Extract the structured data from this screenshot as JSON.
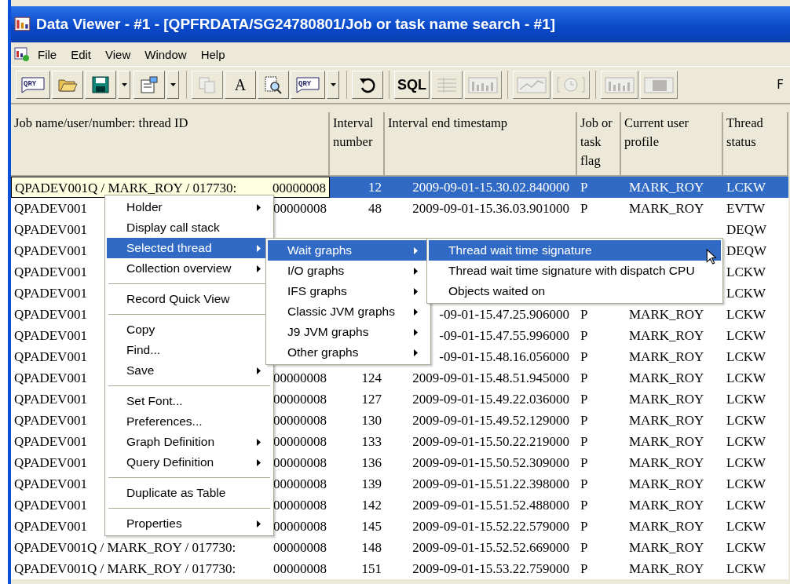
{
  "window": {
    "title": "Data Viewer - #1 - [QPFRDATA/SG24780801/Job or task name search - #1]"
  },
  "menubar": [
    "File",
    "Edit",
    "View",
    "Window",
    "Help"
  ],
  "toolbar": [
    {
      "kind": "qry",
      "label": "QRY",
      "disabled": false,
      "dropdown": false,
      "group_start": false
    },
    {
      "kind": "folder",
      "disabled": false,
      "dropdown": false,
      "group_start": false
    },
    {
      "kind": "save",
      "disabled": false,
      "dropdown": true,
      "group_start": false
    },
    {
      "kind": "properties",
      "disabled": false,
      "dropdown": true,
      "group_start": false
    },
    {
      "kind": "copy",
      "disabled": true,
      "dropdown": false,
      "group_start": true
    },
    {
      "kind": "letter",
      "label": "A",
      "disabled": false,
      "dropdown": false,
      "group_start": false
    },
    {
      "kind": "find",
      "disabled": false,
      "dropdown": false,
      "group_start": false
    },
    {
      "kind": "qry",
      "label": "QRY",
      "disabled": false,
      "dropdown": true,
      "group_start": false
    },
    {
      "kind": "refresh",
      "disabled": false,
      "dropdown": false,
      "group_start": true
    },
    {
      "kind": "letter",
      "label": "SQL",
      "disabled": false,
      "dropdown": false,
      "group_start": true
    },
    {
      "kind": "table",
      "disabled": true,
      "dropdown": false,
      "group_start": false
    },
    {
      "kind": "bars",
      "disabled": true,
      "dropdown": false,
      "group_start": false
    },
    {
      "kind": "line",
      "disabled": true,
      "dropdown": false,
      "group_start": true
    },
    {
      "kind": "clock",
      "disabled": true,
      "dropdown": false,
      "group_start": false
    },
    {
      "kind": "bars",
      "disabled": true,
      "dropdown": false,
      "group_start": true
    },
    {
      "kind": "block",
      "disabled": true,
      "dropdown": false,
      "group_start": false
    }
  ],
  "toolbar_edge_text": "F",
  "table": {
    "columns": [
      "Job name/user/number: thread ID",
      "Interval number",
      "Interval end timestamp",
      "Job or task flag",
      "Current user profile",
      "Thread status"
    ],
    "rows": [
      {
        "job": "QPADEV001Q / MARK_ROY / 017730:",
        "thread": "00000008",
        "interval": "12",
        "timestamp": "2009-09-01-15.30.02.840000",
        "flag": "P",
        "user": "MARK_ROY",
        "status": "LCKW",
        "selected": true
      },
      {
        "job": "QPADEV001",
        "thread": "00000008",
        "interval": "48",
        "timestamp": "2009-09-01-15.36.03.901000",
        "flag": "P",
        "user": "MARK_ROY",
        "status": "EVTW",
        "selected": false
      },
      {
        "job": "QPADEV001",
        "status": "DEQW",
        "selected": false
      },
      {
        "job": "QPADEV001",
        "status": "DEQW",
        "selected": false
      },
      {
        "job": "QPADEV001",
        "status": "LCKW",
        "selected": false
      },
      {
        "job": "QPADEV001",
        "status": "LCKW",
        "selected": false
      },
      {
        "job": "QPADEV001",
        "timestamp": "-09-01-15.47.25.906000",
        "flag": "P",
        "user": "MARK_ROY",
        "status": "LCKW",
        "selected": false
      },
      {
        "job": "QPADEV001",
        "timestamp": "-09-01-15.47.55.996000",
        "flag": "P",
        "user": "MARK_ROY",
        "status": "LCKW",
        "selected": false
      },
      {
        "job": "QPADEV001",
        "timestamp": "-09-01-15.48.16.056000",
        "flag": "P",
        "user": "MARK_ROY",
        "status": "LCKW",
        "selected": false
      },
      {
        "job": "QPADEV001",
        "thread": "00000008",
        "interval": "124",
        "timestamp": "2009-09-01-15.48.51.945000",
        "flag": "P",
        "user": "MARK_ROY",
        "status": "LCKW",
        "selected": false
      },
      {
        "job": "QPADEV001",
        "thread": "00000008",
        "interval": "127",
        "timestamp": "2009-09-01-15.49.22.036000",
        "flag": "P",
        "user": "MARK_ROY",
        "status": "LCKW",
        "selected": false
      },
      {
        "job": "QPADEV001",
        "thread": "00000008",
        "interval": "130",
        "timestamp": "2009-09-01-15.49.52.129000",
        "flag": "P",
        "user": "MARK_ROY",
        "status": "LCKW",
        "selected": false
      },
      {
        "job": "QPADEV001",
        "thread": "00000008",
        "interval": "133",
        "timestamp": "2009-09-01-15.50.22.219000",
        "flag": "P",
        "user": "MARK_ROY",
        "status": "LCKW",
        "selected": false
      },
      {
        "job": "QPADEV001",
        "thread": "00000008",
        "interval": "136",
        "timestamp": "2009-09-01-15.50.52.309000",
        "flag": "P",
        "user": "MARK_ROY",
        "status": "LCKW",
        "selected": false
      },
      {
        "job": "QPADEV001",
        "thread": "00000008",
        "interval": "139",
        "timestamp": "2009-09-01-15.51.22.398000",
        "flag": "P",
        "user": "MARK_ROY",
        "status": "LCKW",
        "selected": false
      },
      {
        "job": "QPADEV001",
        "thread": "00000008",
        "interval": "142",
        "timestamp": "2009-09-01-15.51.52.488000",
        "flag": "P",
        "user": "MARK_ROY",
        "status": "LCKW",
        "selected": false
      },
      {
        "job": "QPADEV001",
        "thread": "00000008",
        "interval": "145",
        "timestamp": "2009-09-01-15.52.22.579000",
        "flag": "P",
        "user": "MARK_ROY",
        "status": "LCKW",
        "selected": false
      },
      {
        "job": "QPADEV001Q / MARK_ROY / 017730:",
        "thread": "00000008",
        "interval": "148",
        "timestamp": "2009-09-01-15.52.52.669000",
        "flag": "P",
        "user": "MARK_ROY",
        "status": "LCKW",
        "selected": false
      },
      {
        "job": "QPADEV001Q / MARK_ROY / 017730:",
        "thread": "00000008",
        "interval": "151",
        "timestamp": "2009-09-01-15.53.22.759000",
        "flag": "P",
        "user": "MARK_ROY",
        "status": "LCKW",
        "selected": false
      }
    ]
  },
  "context_menu": [
    {
      "kind": "item",
      "label": "Holder",
      "submenu": true,
      "selected": false
    },
    {
      "kind": "item",
      "label": "Display call stack",
      "submenu": false,
      "selected": false
    },
    {
      "kind": "item",
      "label": "Selected thread",
      "submenu": true,
      "selected": true
    },
    {
      "kind": "item",
      "label": "Collection overview",
      "submenu": true,
      "selected": false
    },
    {
      "kind": "separator"
    },
    {
      "kind": "item",
      "label": "Record Quick View",
      "submenu": false,
      "selected": false
    },
    {
      "kind": "separator"
    },
    {
      "kind": "item",
      "label": "Copy",
      "submenu": false,
      "selected": false
    },
    {
      "kind": "item",
      "label": "Find...",
      "submenu": false,
      "selected": false
    },
    {
      "kind": "item",
      "label": "Save",
      "submenu": true,
      "selected": false
    },
    {
      "kind": "separator"
    },
    {
      "kind": "item",
      "label": "Set Font...",
      "submenu": false,
      "selected": false
    },
    {
      "kind": "item",
      "label": "Preferences...",
      "submenu": false,
      "selected": false
    },
    {
      "kind": "item",
      "label": "Graph Definition",
      "submenu": true,
      "selected": false
    },
    {
      "kind": "item",
      "label": "Query Definition",
      "submenu": true,
      "selected": false
    },
    {
      "kind": "separator"
    },
    {
      "kind": "item",
      "label": "Duplicate as Table",
      "submenu": false,
      "selected": false
    },
    {
      "kind": "separator"
    },
    {
      "kind": "item",
      "label": "Properties",
      "submenu": true,
      "selected": false
    }
  ],
  "thread_submenu": [
    {
      "kind": "item",
      "label": "Wait graphs",
      "submenu": true,
      "selected": true
    },
    {
      "kind": "item",
      "label": "I/O graphs",
      "submenu": true,
      "selected": false
    },
    {
      "kind": "item",
      "label": "IFS graphs",
      "submenu": true,
      "selected": false
    },
    {
      "kind": "item",
      "label": "Classic JVM graphs",
      "submenu": true,
      "selected": false
    },
    {
      "kind": "item",
      "label": "J9 JVM graphs",
      "submenu": true,
      "selected": false
    },
    {
      "kind": "item",
      "label": "Other graphs",
      "submenu": true,
      "selected": false
    }
  ],
  "wait_submenu": [
    {
      "kind": "item",
      "label": "Thread wait time signature",
      "submenu": false,
      "selected": true
    },
    {
      "kind": "item",
      "label": "Thread wait time signature with dispatch CPU",
      "submenu": false,
      "selected": false
    },
    {
      "kind": "item",
      "label": "Objects waited on",
      "submenu": false,
      "selected": false
    }
  ]
}
